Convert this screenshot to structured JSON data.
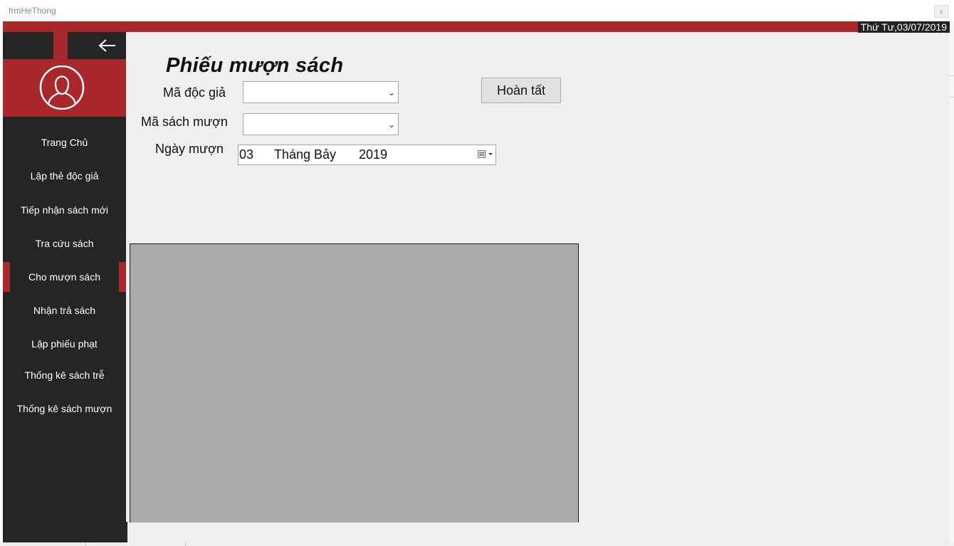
{
  "window": {
    "title": "frmHeThong",
    "close_label": "x"
  },
  "header": {
    "date_label": "Thứ Tư,03/07/2019",
    "accent_color": "#a8282b"
  },
  "sidebar": {
    "back_icon": "arrow-left-icon",
    "profile_icon": "user-avatar-icon",
    "items": [
      {
        "label": "Trang Chủ"
      },
      {
        "label": "Lập thẻ độc giả"
      },
      {
        "label": "Tiếp nhận sách mới"
      },
      {
        "label": "Tra cứu sách"
      },
      {
        "label": "Cho  mượn sách",
        "active": true
      },
      {
        "label": "Nhận trả sách"
      },
      {
        "label": "Lập phiếu phạt"
      },
      {
        "label": "Thống kê sách trễ"
      },
      {
        "label": "Thống kê sách mượn"
      }
    ]
  },
  "form": {
    "title": "Phiếu mượn sách",
    "reader_id_label": "Mã độc giả",
    "reader_id_value": "",
    "book_id_label": "Mã sách mượn",
    "book_id_value": "",
    "borrow_date_label": "Ngày mượn",
    "borrow_date": {
      "day": "03",
      "month": "Tháng Bảy",
      "year": "2019"
    },
    "done_button": "Hoàn tất"
  }
}
